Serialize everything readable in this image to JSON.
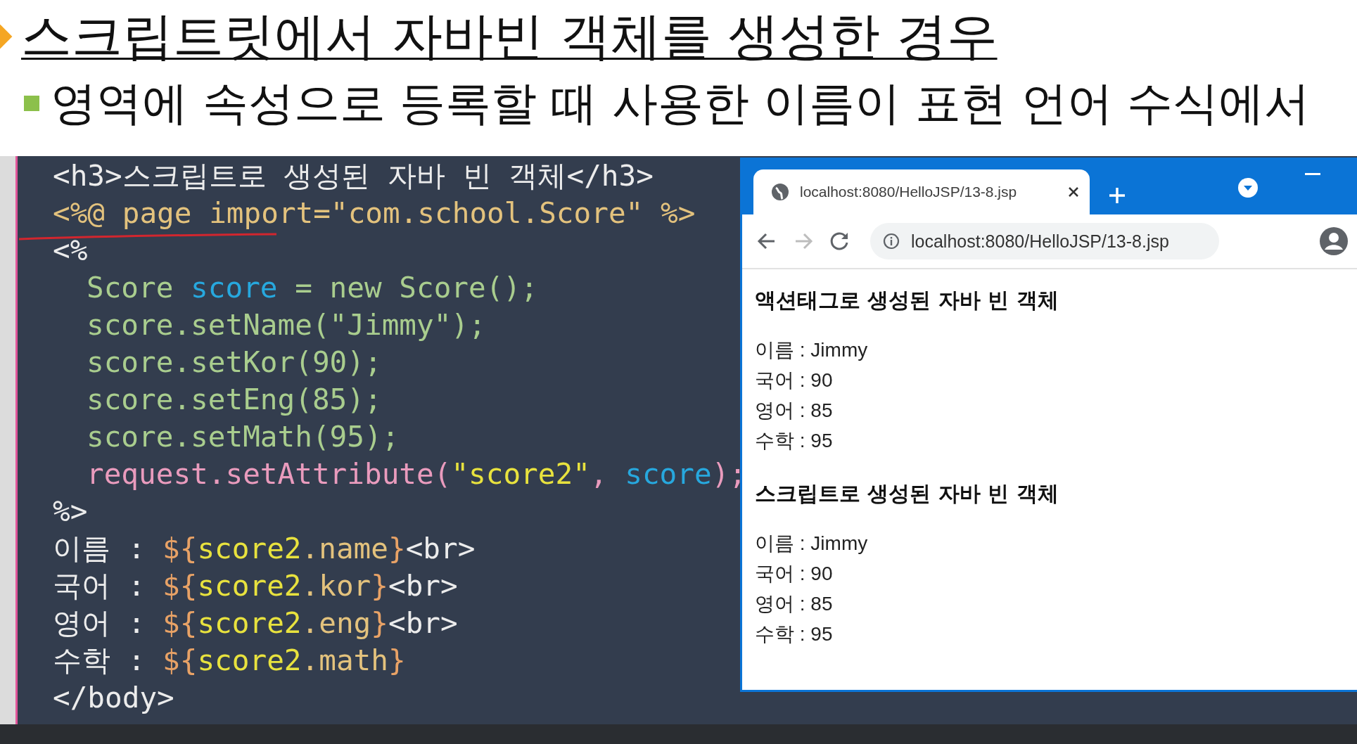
{
  "slide": {
    "title": "스크립트릿에서 자바빈 객체를 생성한 경우",
    "subtitle": "영역에 속성으로 등록할 때 사용한 이름이 표현 언어 수식에서"
  },
  "editor": {
    "lines": [
      {
        "indented": false,
        "tokens": [
          {
            "text": "<h3>스크립트로 생성된 자바 빈 객체</h3>",
            "kind": "tag"
          }
        ]
      },
      {
        "indented": false,
        "tokens": [
          {
            "text": "<%@ page import=\"com.school.Score\" %>",
            "kind": "directive"
          }
        ]
      },
      {
        "indented": false,
        "tokens": [
          {
            "text": "<%",
            "kind": "tag"
          }
        ]
      },
      {
        "indented": true,
        "tokens": [
          {
            "text": "Score ",
            "kind": "java"
          },
          {
            "text": "score",
            "kind": "var"
          },
          {
            "text": " = new Score();",
            "kind": "java"
          }
        ]
      },
      {
        "indented": true,
        "tokens": [
          {
            "text": "score.setName(\"Jimmy\");",
            "kind": "java"
          }
        ]
      },
      {
        "indented": true,
        "tokens": [
          {
            "text": "score.setKor(90);",
            "kind": "java"
          }
        ]
      },
      {
        "indented": true,
        "tokens": [
          {
            "text": "score.setEng(85);",
            "kind": "java"
          }
        ]
      },
      {
        "indented": true,
        "tokens": [
          {
            "text": "score.setMath(95);",
            "kind": "java"
          }
        ]
      },
      {
        "indented": true,
        "tokens": [
          {
            "text": "request.setAttribute(",
            "kind": "call"
          },
          {
            "text": "\"score2\"",
            "kind": "string"
          },
          {
            "text": ", ",
            "kind": "call"
          },
          {
            "text": "score",
            "kind": "var"
          },
          {
            "text": ");",
            "kind": "call"
          }
        ]
      },
      {
        "indented": false,
        "tokens": [
          {
            "text": "%>",
            "kind": "tag"
          }
        ]
      },
      {
        "indented": false,
        "tokens": [
          {
            "text": "이름 : ",
            "kind": "tag"
          },
          {
            "text": "${",
            "kind": "brace"
          },
          {
            "text": "score2",
            "kind": "string"
          },
          {
            "text": ".name",
            "kind": "prop"
          },
          {
            "text": "}",
            "kind": "brace"
          },
          {
            "text": "<br>",
            "kind": "tag"
          }
        ]
      },
      {
        "indented": false,
        "tokens": [
          {
            "text": "국어 : ",
            "kind": "tag"
          },
          {
            "text": "${",
            "kind": "brace"
          },
          {
            "text": "score2",
            "kind": "string"
          },
          {
            "text": ".kor",
            "kind": "prop"
          },
          {
            "text": "}",
            "kind": "brace"
          },
          {
            "text": "<br>",
            "kind": "tag"
          }
        ]
      },
      {
        "indented": false,
        "tokens": [
          {
            "text": "영어 : ",
            "kind": "tag"
          },
          {
            "text": "${",
            "kind": "brace"
          },
          {
            "text": "score2",
            "kind": "string"
          },
          {
            "text": ".eng",
            "kind": "prop"
          },
          {
            "text": "}",
            "kind": "brace"
          },
          {
            "text": "<br>",
            "kind": "tag"
          }
        ]
      },
      {
        "indented": false,
        "tokens": [
          {
            "text": "수학 : ",
            "kind": "tag"
          },
          {
            "text": "${",
            "kind": "brace"
          },
          {
            "text": "score2",
            "kind": "string"
          },
          {
            "text": ".math",
            "kind": "prop"
          },
          {
            "text": "}",
            "kind": "brace"
          }
        ]
      },
      {
        "indented": false,
        "tokens": [
          {
            "text": "</body>",
            "kind": "tag"
          }
        ]
      }
    ]
  },
  "browser": {
    "tab_title": "localhost:8080/HelloJSP/13-8.jsp",
    "address": "localhost:8080/HelloJSP/13-8.jsp",
    "sections": [
      {
        "heading": "액션태그로 생성된 자바 빈 객체",
        "lines": [
          "이름 : Jimmy",
          "국어 : 90",
          "영어 : 85",
          "수학 : 95"
        ]
      },
      {
        "heading": "스크립트로 생성된 자바 빈 객체",
        "lines": [
          "이름 : Jimmy",
          "국어 : 90",
          "영어 : 85",
          "수학 : 95"
        ]
      }
    ]
  }
}
